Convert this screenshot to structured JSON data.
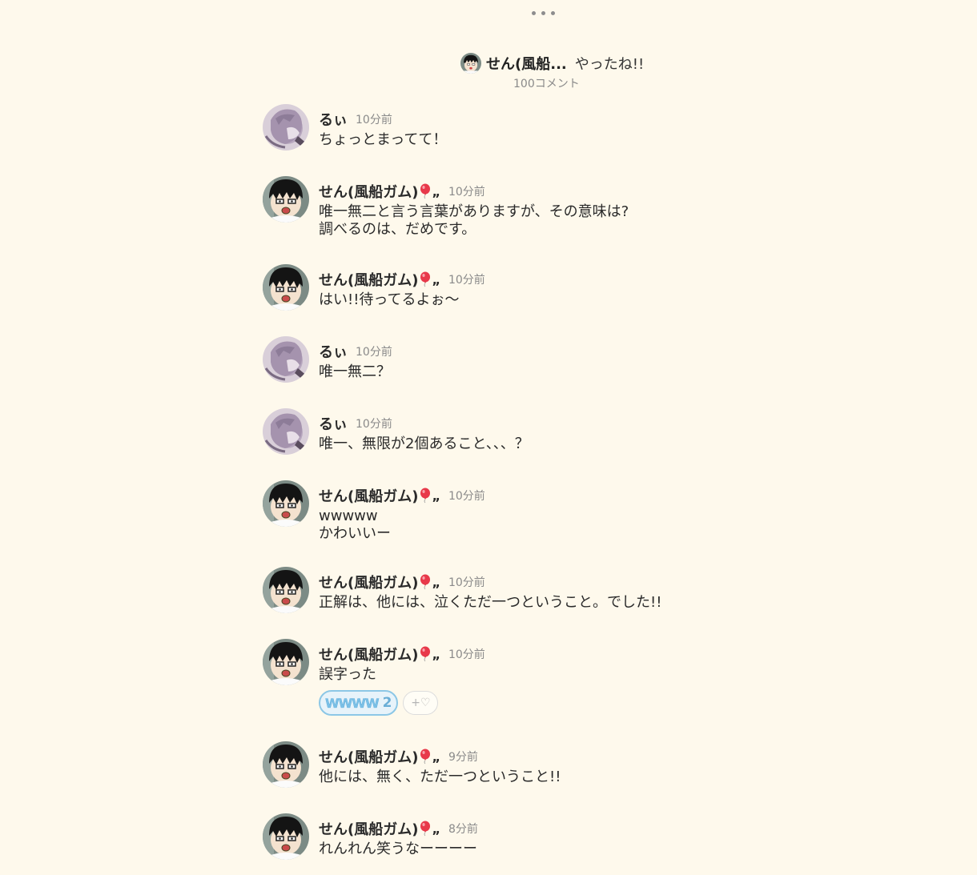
{
  "thread": {
    "author": "せん(風船...",
    "title": "やったね!!",
    "comment_count": "100コメント"
  },
  "comments": [
    {
      "author": "るぃ",
      "badge": false,
      "time": "10分前",
      "text": "ちょっとまってて！",
      "avatar": "rui-avatar"
    },
    {
      "author": "せん(風船ガム)",
      "badge": true,
      "badge_suffix": "„",
      "time": "10分前",
      "text": "唯一無二と言う言葉がありますが、その意味は?\n調べるのは、だめです。",
      "avatar": "sen-avatar"
    },
    {
      "author": "せん(風船ガム)",
      "badge": true,
      "badge_suffix": "„",
      "time": "10分前",
      "text": "はい!!待ってるよぉ〜",
      "avatar": "sen-avatar"
    },
    {
      "author": "るぃ",
      "badge": false,
      "time": "10分前",
      "text": "唯一無二？",
      "avatar": "rui-avatar"
    },
    {
      "author": "るぃ",
      "badge": false,
      "time": "10分前",
      "text": "唯一、無限が2個あること、、、？",
      "avatar": "rui-avatar"
    },
    {
      "author": "せん(風船ガム)",
      "badge": true,
      "badge_suffix": "„",
      "time": "10分前",
      "text": "wwwww\nかわいいー",
      "avatar": "sen-avatar"
    },
    {
      "author": "せん(風船ガム)",
      "badge": true,
      "badge_suffix": "„",
      "time": "10分前",
      "text": "正解は、他には、泣くただ一つということ。でした!!",
      "avatar": "sen-avatar"
    },
    {
      "author": "せん(風船ガム)",
      "badge": true,
      "badge_suffix": "„",
      "time": "10分前",
      "text": "誤字った",
      "avatar": "sen-avatar",
      "reaction": {
        "label": "WWWW",
        "count": "2"
      },
      "add_reaction_label": "+♡"
    },
    {
      "author": "せん(風船ガム)",
      "badge": true,
      "badge_suffix": "„",
      "time": "9分前",
      "text": "他には、無く、ただ一つということ!!",
      "avatar": "sen-avatar"
    },
    {
      "author": "せん(風船ガム)",
      "badge": true,
      "badge_suffix": "„",
      "time": "8分前",
      "text": "れんれん笑うなーーーー",
      "avatar": "sen-avatar"
    }
  ],
  "colors": {
    "background": "#fef9ec",
    "reaction_border": "#8cc7e6",
    "balloon": "#e8394a"
  },
  "icons": {
    "menu": "more-dots-icon",
    "badge": "balloon-icon",
    "add_reaction": "heart-plus-icon"
  }
}
